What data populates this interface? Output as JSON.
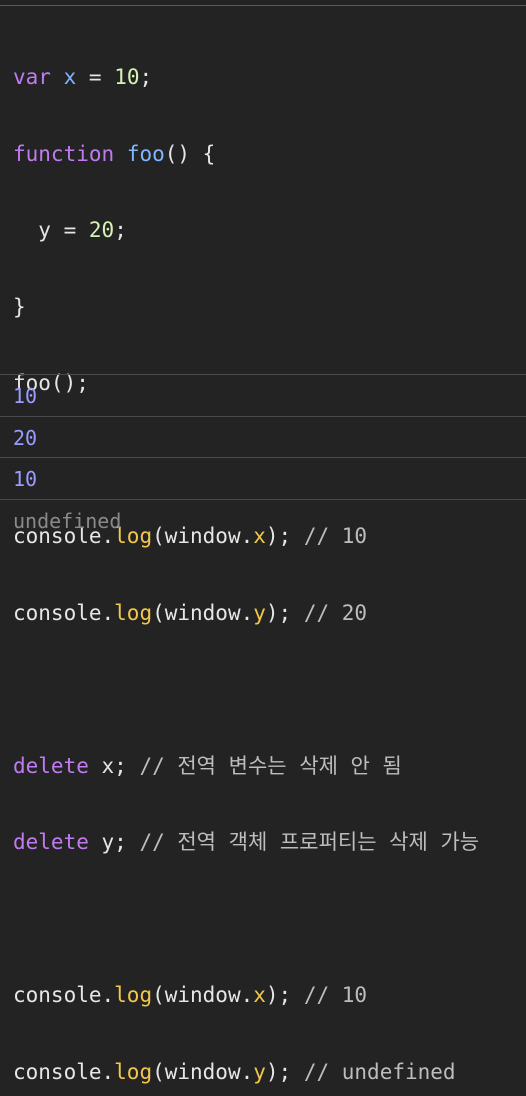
{
  "code": {
    "line1": {
      "kw": "var",
      "sp1": " ",
      "id": "x",
      "op": " = ",
      "num": "10",
      "end": ";"
    },
    "line2": {
      "kw": "function",
      "sp1": " ",
      "fn": "foo",
      "rest": "() {"
    },
    "line3": {
      "indent": "  ",
      "id": "y",
      "op": " = ",
      "num": "20",
      "end": ";"
    },
    "line4": {
      "text": "}"
    },
    "line5": {
      "text": "foo();"
    },
    "log1": {
      "obj": "console.",
      "method": "log",
      "open": "(window.",
      "prop": "x",
      "close": "); ",
      "comment": "// 10"
    },
    "log2": {
      "obj": "console.",
      "method": "log",
      "open": "(window.",
      "prop": "y",
      "close": "); ",
      "comment": "// 20"
    },
    "del1": {
      "kw": "delete",
      "rest": " x; ",
      "comment": "// 전역 변수는 삭제 안 됨"
    },
    "del2": {
      "kw": "delete",
      "rest": " y; ",
      "comment": "// 전역 객체 프로퍼티는 삭제 가능"
    },
    "log3": {
      "obj": "console.",
      "method": "log",
      "open": "(window.",
      "prop": "x",
      "close": "); ",
      "comment": "// 10"
    },
    "log4": {
      "obj": "console.",
      "method": "log",
      "open": "(window.",
      "prop": "y",
      "close": "); ",
      "comment": "// undefined"
    }
  },
  "console_output": [
    {
      "value": "10",
      "type": "number"
    },
    {
      "value": "20",
      "type": "number"
    },
    {
      "value": "10",
      "type": "number"
    },
    {
      "value": "undefined",
      "type": "undefined"
    }
  ],
  "colors": {
    "background": "#232323",
    "keyword": "#c07bf0",
    "function_name": "#7fb6ff",
    "number_literal": "#d6f2b6",
    "property": "#f2c74a",
    "comment": "#bdbdbd",
    "output_number": "#9a9cff",
    "output_undefined": "#8a8a8a"
  }
}
